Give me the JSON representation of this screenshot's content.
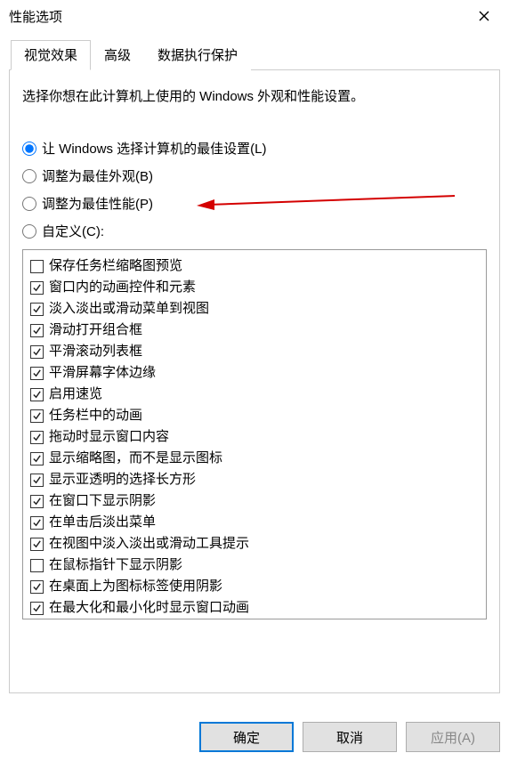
{
  "window": {
    "title": "性能选项"
  },
  "tabs": {
    "visual": "视觉效果",
    "advanced": "高级",
    "dep": "数据执行保护"
  },
  "description": "选择你想在此计算机上使用的 Windows 外观和性能设置。",
  "radios": {
    "auto": "让 Windows 选择计算机的最佳设置(L)",
    "best_appearance": "调整为最佳外观(B)",
    "best_performance": "调整为最佳性能(P)",
    "custom": "自定义(C):"
  },
  "radio_selected": "auto",
  "checklist": [
    {
      "label": "保存任务栏缩略图预览",
      "checked": false
    },
    {
      "label": "窗口内的动画控件和元素",
      "checked": true
    },
    {
      "label": "淡入淡出或滑动菜单到视图",
      "checked": true
    },
    {
      "label": "滑动打开组合框",
      "checked": true
    },
    {
      "label": "平滑滚动列表框",
      "checked": true
    },
    {
      "label": "平滑屏幕字体边缘",
      "checked": true
    },
    {
      "label": "启用速览",
      "checked": true
    },
    {
      "label": "任务栏中的动画",
      "checked": true
    },
    {
      "label": "拖动时显示窗口内容",
      "checked": true
    },
    {
      "label": "显示缩略图，而不是显示图标",
      "checked": true
    },
    {
      "label": "显示亚透明的选择长方形",
      "checked": true
    },
    {
      "label": "在窗口下显示阴影",
      "checked": true
    },
    {
      "label": "在单击后淡出菜单",
      "checked": true
    },
    {
      "label": "在视图中淡入淡出或滑动工具提示",
      "checked": true
    },
    {
      "label": "在鼠标指针下显示阴影",
      "checked": false
    },
    {
      "label": "在桌面上为图标标签使用阴影",
      "checked": true
    },
    {
      "label": "在最大化和最小化时显示窗口动画",
      "checked": true
    }
  ],
  "buttons": {
    "ok": "确定",
    "cancel": "取消",
    "apply": "应用(A)"
  }
}
